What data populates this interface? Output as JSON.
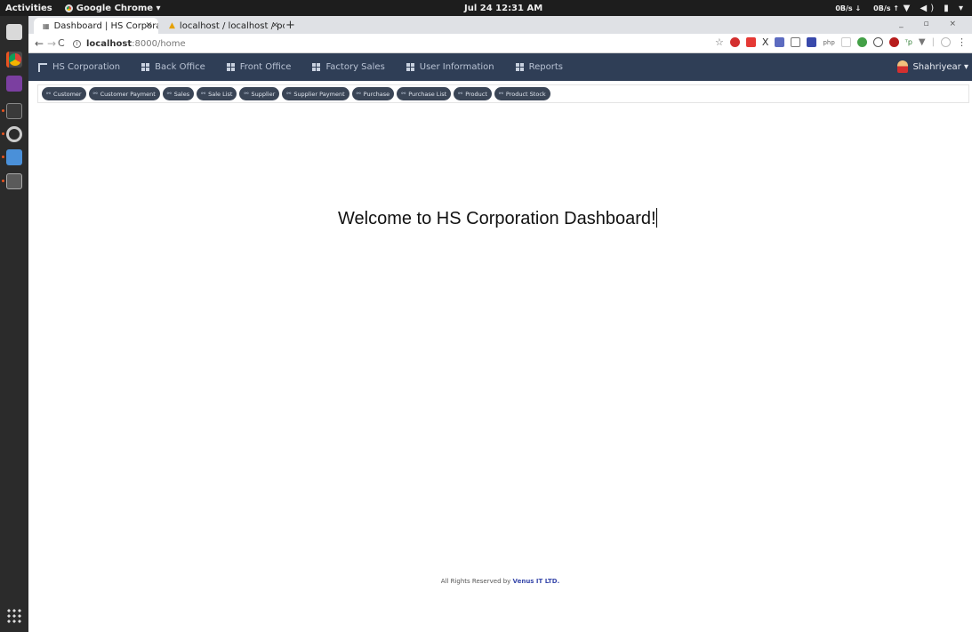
{
  "system": {
    "activities": "Activities",
    "app_menu": "Google Chrome ▾",
    "clock": "Jul 24  12:31 AM",
    "net_down": "0B/s ↓",
    "net_up": "0B/s ↑",
    "tray": "▼ ◀) ▮ ▾"
  },
  "browser": {
    "tabs": [
      {
        "title": "Dashboard | HS Corporati",
        "favicon": "dashboard-favicon",
        "active": true
      },
      {
        "title": "localhost / localhost / po",
        "favicon": "phpmyadmin-favicon",
        "active": false
      }
    ],
    "new_tab": "+",
    "window_controls": "_ ▫ ×",
    "url_host": "localhost",
    "url_path": ":8000/home"
  },
  "app": {
    "brand": "HS Corporation",
    "nav": [
      "Back Office",
      "Front Office",
      "Factory Sales",
      "User Information",
      "Reports"
    ],
    "user": "Shahriyear ▾",
    "quick_links": [
      "Customer",
      "Customer Payment",
      "Sales",
      "Sale List",
      "Supplier",
      "Supplier Payment",
      "Purchase",
      "Purchase List",
      "Product",
      "Product Stock"
    ],
    "welcome": "Welcome to HS Corporation Dashboard!",
    "footer_prefix": "All Rights Reserved by ",
    "footer_company": "Venus IT LTD."
  },
  "colors": {
    "navbar": "#2f3e56",
    "pill": "#3a4556",
    "link": "#3949ab"
  }
}
